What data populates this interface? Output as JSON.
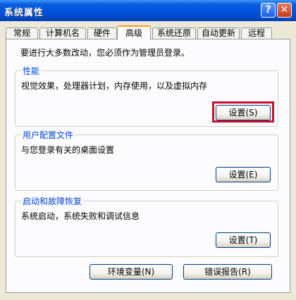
{
  "window": {
    "title": "系统属性",
    "help_glyph": "?",
    "close_glyph": "✕"
  },
  "tabs": [
    {
      "label": "常规",
      "active": false
    },
    {
      "label": "计算机名",
      "active": false
    },
    {
      "label": "硬件",
      "active": false
    },
    {
      "label": "高级",
      "active": true
    },
    {
      "label": "系统还原",
      "active": false
    },
    {
      "label": "自动更新",
      "active": false
    },
    {
      "label": "远程",
      "active": false
    }
  ],
  "advanced": {
    "intro": "要进行大多数改动，您必须作为管理员登录。",
    "performance": {
      "title": "性能",
      "description": "视觉效果，处理器计划，内存使用，以及虚拟内存",
      "button": "设置(S)"
    },
    "user_profiles": {
      "title": "用户配置文件",
      "description": "与您登录有关的桌面设置",
      "button": "设置(E)"
    },
    "startup_recovery": {
      "title": "启动和故障恢复",
      "description": "系统启动，系统失败和调试信息",
      "button": "设置(T)"
    },
    "env_button": "环境变量(N)",
    "error_report_button": "错误报告(R)"
  },
  "colors": {
    "titlebar": "#0054e3",
    "active_tab_accent": "#ff9a1a",
    "group_title": "#0046d5",
    "highlight": "#c8102e"
  }
}
